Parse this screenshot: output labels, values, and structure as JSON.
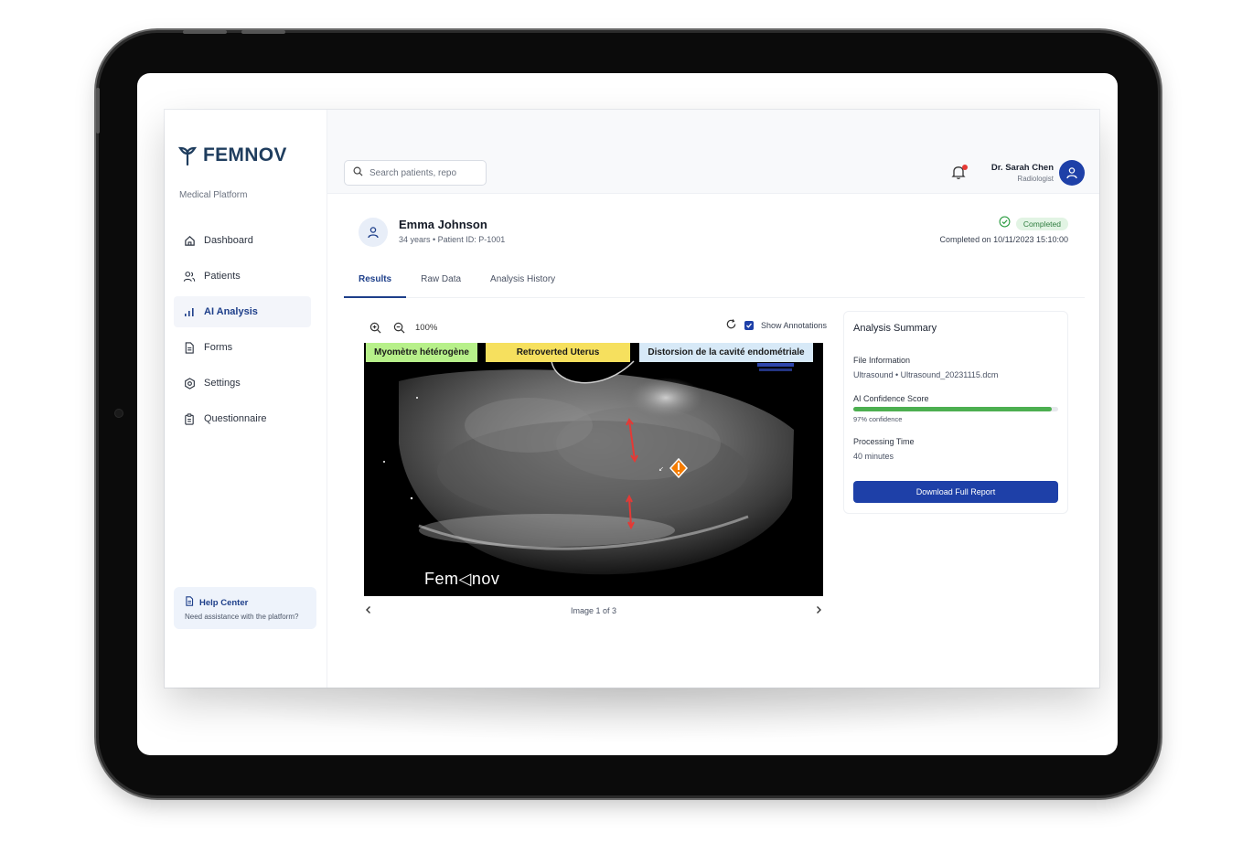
{
  "brand": {
    "name": "FEMNOV",
    "subtitle": "Medical Platform"
  },
  "sidebar": {
    "items": [
      {
        "label": "Dashboard",
        "icon": "home-icon",
        "active": false
      },
      {
        "label": "Patients",
        "icon": "users-icon",
        "active": false
      },
      {
        "label": "AI Analysis",
        "icon": "bar-chart-icon",
        "active": true
      },
      {
        "label": "Forms",
        "icon": "document-icon",
        "active": false
      },
      {
        "label": "Settings",
        "icon": "gear-icon",
        "active": false
      },
      {
        "label": "Questionnaire",
        "icon": "clipboard-icon",
        "active": false
      }
    ],
    "help": {
      "title": "Help Center",
      "subtitle": "Need assistance with the platform?"
    }
  },
  "header": {
    "search_placeholder": "Search patients, repo",
    "user": {
      "name": "Dr. Sarah Chen",
      "role": "Radiologist"
    }
  },
  "patient": {
    "name": "Emma Johnson",
    "meta": "34 years • Patient ID: P-1001",
    "status": "Completed",
    "completed_at": "Completed on 10/11/2023 15:10:00"
  },
  "tabs": [
    "Results",
    "Raw Data",
    "Analysis History"
  ],
  "viewer": {
    "zoom": "100%",
    "show_annotations_label": "Show Annotations",
    "annotation_labels": [
      {
        "text": "Myomètre hétérogène",
        "color": "#b7f08a"
      },
      {
        "text": "Retroverted Uterus",
        "color": "#f6e05e"
      },
      {
        "text": "Distorsion de la cavité endométriale",
        "color": "#d7e9f7"
      }
    ],
    "watermark": "Fem◁nov",
    "pager": "Image 1 of 3"
  },
  "summary": {
    "title": "Analysis Summary",
    "file_label": "File Information",
    "file_value": "Ultrasound • Ultrasound_20231115.dcm",
    "confidence_label": "AI Confidence Score",
    "confidence_value": 0.97,
    "confidence_text": "97% confidence",
    "processing_label": "Processing Time",
    "processing_value": "40 minutes",
    "download_label": "Download Full Report"
  },
  "colors": {
    "primary": "#1e40a8",
    "success": "#4caf50",
    "brand": "#1f3d5e"
  }
}
